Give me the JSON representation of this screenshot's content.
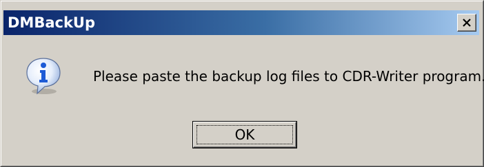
{
  "window": {
    "title": "DMBackUp",
    "close_label": "×"
  },
  "dialog": {
    "icon": "information-icon",
    "message": "Please paste the backup log files to CDR-Writer program.",
    "ok_label": "OK"
  },
  "colors": {
    "titlebar_start": "#0a246a",
    "titlebar_end": "#a6caf0",
    "dialog_bg": "#d4d0c8",
    "info_icon_blue": "#1e5bd6"
  }
}
